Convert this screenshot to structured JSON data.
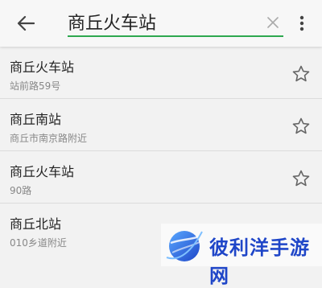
{
  "search": {
    "query": "商丘火车站",
    "accent_color": "#2ea84f"
  },
  "icons": {
    "back": "arrow-left-icon",
    "clear": "close-icon",
    "more": "more-vert-icon",
    "favorite": "star-outline-icon"
  },
  "results": [
    {
      "name": "商丘火车站",
      "address": "站前路59号"
    },
    {
      "name": "商丘南站",
      "address": "商丘市南京路附近"
    },
    {
      "name": "商丘火车站",
      "address": "90路"
    },
    {
      "name": "商丘北站",
      "address": "010乡道附近"
    }
  ],
  "watermark": {
    "text": "彼利洋手游网",
    "color": "#1f46c8"
  }
}
